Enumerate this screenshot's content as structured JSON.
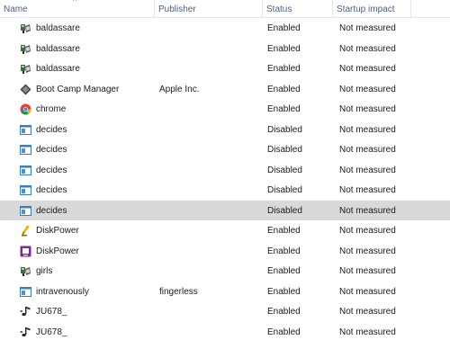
{
  "columns": {
    "name": "Name",
    "publisher": "Publisher",
    "status": "Status",
    "impact": "Startup impact"
  },
  "rows": [
    {
      "icon": "app-installer-icon",
      "name": "baldassare",
      "publisher": "",
      "status": "Enabled",
      "impact": "Not measured",
      "selected": false
    },
    {
      "icon": "app-installer-icon",
      "name": "baldassare",
      "publisher": "",
      "status": "Enabled",
      "impact": "Not measured",
      "selected": false
    },
    {
      "icon": "app-installer-icon",
      "name": "baldassare",
      "publisher": "",
      "status": "Enabled",
      "impact": "Not measured",
      "selected": false
    },
    {
      "icon": "boot-camp-icon",
      "name": "Boot Camp Manager",
      "publisher": "Apple Inc.",
      "status": "Enabled",
      "impact": "Not measured",
      "selected": false
    },
    {
      "icon": "chrome-icon",
      "name": "chrome",
      "publisher": "",
      "status": "Enabled",
      "impact": "Not measured",
      "selected": false
    },
    {
      "icon": "window-app-icon",
      "name": "decides",
      "publisher": "",
      "status": "Disabled",
      "impact": "Not measured",
      "selected": false
    },
    {
      "icon": "window-app-icon",
      "name": "decides",
      "publisher": "",
      "status": "Disabled",
      "impact": "Not measured",
      "selected": false
    },
    {
      "icon": "window-app-icon",
      "name": "decides",
      "publisher": "",
      "status": "Disabled",
      "impact": "Not measured",
      "selected": false
    },
    {
      "icon": "window-app-icon",
      "name": "decides",
      "publisher": "",
      "status": "Disabled",
      "impact": "Not measured",
      "selected": false
    },
    {
      "icon": "window-app-icon",
      "name": "decides",
      "publisher": "",
      "status": "Disabled",
      "impact": "Not measured",
      "selected": true
    },
    {
      "icon": "disk-power-yellow-icon",
      "name": "DiskPower",
      "publisher": "",
      "status": "Enabled",
      "impact": "Not measured",
      "selected": false
    },
    {
      "icon": "disk-power-purple-icon",
      "name": "DiskPower",
      "publisher": "",
      "status": "Enabled",
      "impact": "Not measured",
      "selected": false
    },
    {
      "icon": "app-installer-icon",
      "name": "girls",
      "publisher": "",
      "status": "Enabled",
      "impact": "Not measured",
      "selected": false
    },
    {
      "icon": "window-app-icon",
      "name": "intravenously",
      "publisher": "fingerless",
      "status": "Enabled",
      "impact": "Not measured",
      "selected": false
    },
    {
      "icon": "music-note-icon",
      "name": "JU678_",
      "publisher": "",
      "status": "Enabled",
      "impact": "Not measured",
      "selected": false
    },
    {
      "icon": "music-note-icon",
      "name": "JU678_",
      "publisher": "",
      "status": "Enabled",
      "impact": "Not measured",
      "selected": false
    }
  ]
}
